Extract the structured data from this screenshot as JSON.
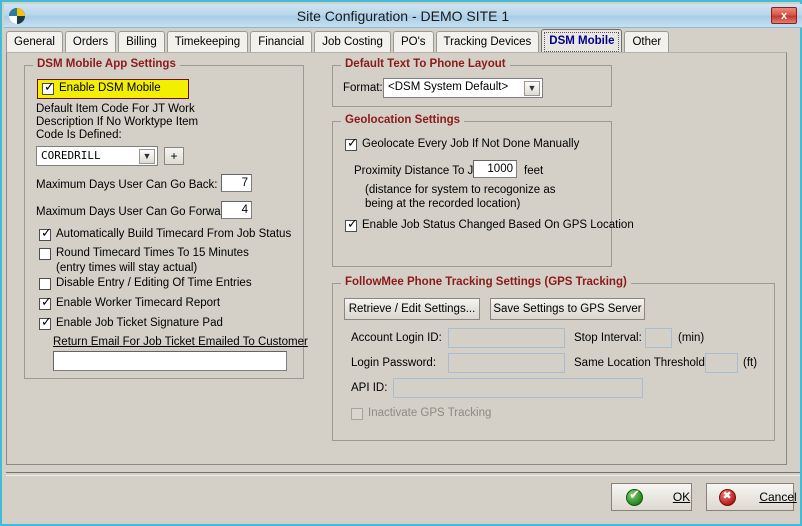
{
  "window": {
    "title": "Site Configuration - DEMO SITE 1",
    "icon": "pie-chart-icon",
    "close_label": "x"
  },
  "tabs": [
    {
      "label": "General",
      "selected": false
    },
    {
      "label": "Orders",
      "selected": false
    },
    {
      "label": "Billing",
      "selected": false
    },
    {
      "label": "Timekeeping",
      "selected": false
    },
    {
      "label": "Financial",
      "selected": false
    },
    {
      "label": "Job Costing",
      "selected": false
    },
    {
      "label": "PO's",
      "selected": false
    },
    {
      "label": "Tracking Devices",
      "selected": false
    },
    {
      "label": "DSM Mobile",
      "selected": true
    },
    {
      "label": "Other",
      "selected": false
    }
  ],
  "app_settings": {
    "legend": "DSM Mobile App Settings",
    "enable_dsm_mobile": {
      "label": "Enable DSM Mobile",
      "checked": true,
      "highlighted": true
    },
    "default_item_code_label_line1": "Default Item Code For  JT Work",
    "default_item_code_label_line2": "Description If No Worktype Item",
    "default_item_code_label_line3": "Code Is Defined:",
    "item_code_value": "COREDRILL",
    "add_button_label": "+",
    "max_days_back_label": "Maximum Days User Can Go Back:",
    "max_days_back_value": "7",
    "max_days_forward_label": "Maximum Days User Can Go Forward:",
    "max_days_forward_value": "4",
    "checkboxes": [
      {
        "label": "Automatically Build Timecard From Job Status",
        "checked": true
      },
      {
        "label": "Round Timecard Times To 15 Minutes",
        "checked": false
      },
      {
        "label": "Disable Entry / Editing Of Time Entries",
        "checked": false
      },
      {
        "label": "Enable  Worker Timecard Report",
        "checked": true
      },
      {
        "label": "Enable Job Ticket Signature Pad",
        "checked": true
      }
    ],
    "round_note": "(entry times will stay actual)",
    "return_email_label": "Return Email For Job Ticket Emailed To Customer",
    "return_email_value": ""
  },
  "text_layout": {
    "legend": "Default Text To Phone Layout",
    "format_label": "Format:",
    "format_value": "<DSM System Default>"
  },
  "geolocation": {
    "legend": "Geolocation Settings",
    "geolocate_every_job": {
      "label": "Geolocate Every Job If Not Done Manually",
      "checked": true
    },
    "proximity_label": "Proximity Distance To Job:",
    "proximity_value": "1000",
    "proximity_unit": "feet",
    "note_line1": "(distance for system to recogonize as",
    "note_line2": "being at the recorded location)",
    "gps_status_change": {
      "label": "Enable Job Status Changed Based On GPS Location",
      "checked": true
    }
  },
  "followmee": {
    "legend": "FollowMee Phone Tracking Settings (GPS Tracking)",
    "retrieve_button": "Retrieve / Edit Settings...",
    "save_button": "Save Settings to GPS Server",
    "account_login_label": "Account Login ID:",
    "account_login_value": "",
    "login_password_label": "Login Password:",
    "login_password_value": "",
    "api_id_label": "API ID:",
    "api_id_value": "",
    "stop_interval_label": "Stop Interval:",
    "stop_interval_value": "",
    "stop_interval_unit": "(min)",
    "same_location_label": "Same Location Threshold:",
    "same_location_value": "",
    "same_location_unit": "(ft)",
    "inactivate": {
      "label": "Inactivate GPS Tracking",
      "checked": false
    }
  },
  "footer": {
    "ok_label": "OK",
    "ok_accel": "O",
    "cancel_label": "Cancel",
    "cancel_accel": "C"
  }
}
